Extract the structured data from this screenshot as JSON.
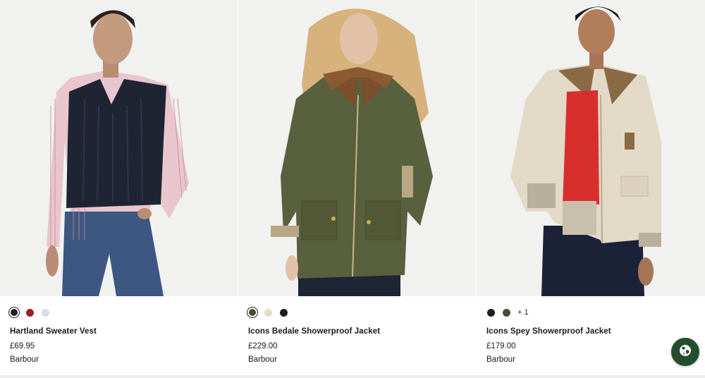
{
  "products": [
    {
      "name": "Hartland Sweater Vest",
      "price": "£69.95",
      "brand": "Barbour",
      "swatches": [
        {
          "color": "#1c1c1c",
          "selected": true
        },
        {
          "color": "#9c1f25",
          "selected": false
        },
        {
          "color": "#d6dde6",
          "selected": false
        }
      ],
      "more_colors": ""
    },
    {
      "name": "Icons Bedale Showerproof Jacket",
      "price": "£229.00",
      "brand": "Barbour",
      "swatches": [
        {
          "color": "#4a4b33",
          "selected": true
        },
        {
          "color": "#e6dccb",
          "selected": false
        },
        {
          "color": "#1c1c1c",
          "selected": false
        }
      ],
      "more_colors": ""
    },
    {
      "name": "Icons Spey Showerproof Jacket",
      "price": "£179.00",
      "brand": "Barbour",
      "swatches": [
        {
          "color": "#1c1c1c",
          "selected": false
        },
        {
          "color": "#4a4b33",
          "selected": false
        }
      ],
      "more_colors": "+ 1"
    }
  ],
  "colors": {
    "photo_bg": "#f1f1f0",
    "globe_button": "#234d2c"
  },
  "icons": {
    "globe": "globe-icon"
  }
}
